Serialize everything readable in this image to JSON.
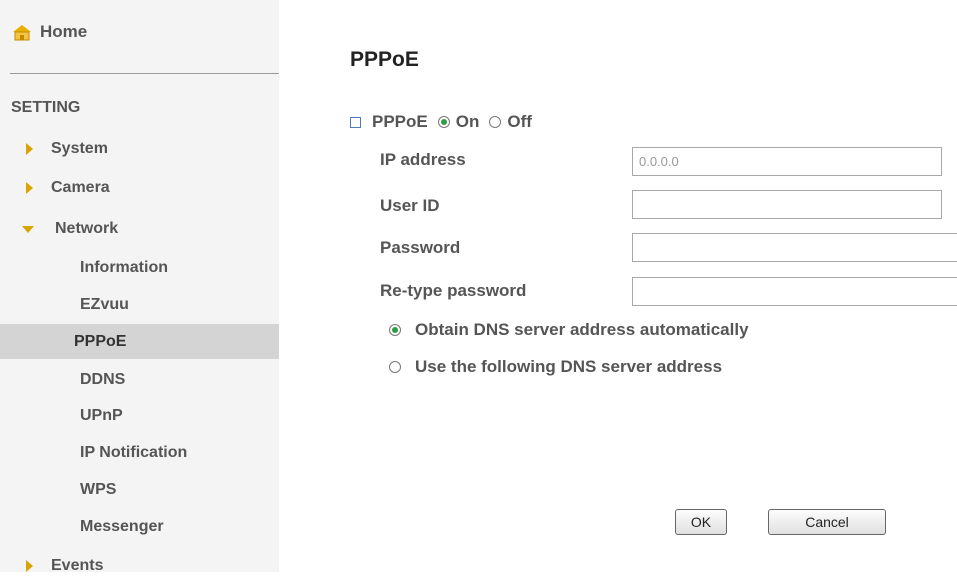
{
  "sidebar": {
    "home_label": "Home",
    "section_title": "SETTING",
    "menu": [
      {
        "label": "System"
      },
      {
        "label": "Camera"
      },
      {
        "label": "Network"
      },
      {
        "label": "Events"
      }
    ],
    "network_items": [
      {
        "label": "Information"
      },
      {
        "label": "EZvuu"
      },
      {
        "label": "PPPoE"
      },
      {
        "label": "DDNS"
      },
      {
        "label": "UPnP"
      },
      {
        "label": "IP Notification"
      },
      {
        "label": "WPS"
      },
      {
        "label": "Messenger"
      }
    ]
  },
  "main": {
    "title": "PPPoE",
    "pppoe_label": "PPPoE",
    "on_label": "On",
    "off_label": "Off",
    "ip_address_label": "IP address",
    "ip_address_value": "0.0.0.0",
    "user_id_label": "User ID",
    "password_label": "Password",
    "retype_label": "Re-type password",
    "dns_auto_label": "Obtain DNS server address automatically",
    "dns_manual_label": "Use the following DNS server address",
    "ok_label": "OK",
    "cancel_label": "Cancel"
  },
  "colors": {
    "accent_arrow": "#d9a300",
    "radio_selected": "#2e9d45",
    "active_item_bg": "#d4d4d4"
  },
  "icons": [
    "home-icon",
    "arrow-right-icon",
    "arrow-down-icon",
    "square-bullet-icon"
  ]
}
